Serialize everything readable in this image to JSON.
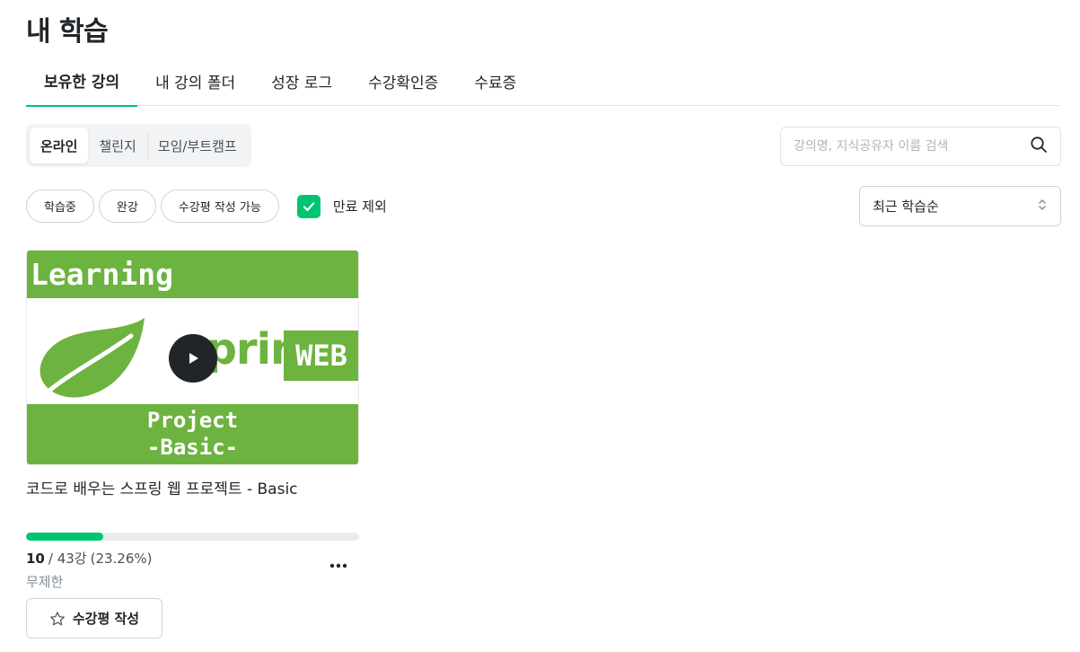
{
  "page_title": "내 학습",
  "tabs": [
    {
      "label": "보유한 강의",
      "active": true
    },
    {
      "label": "내 강의 폴더"
    },
    {
      "label": "성장 로그"
    },
    {
      "label": "수강확인증"
    },
    {
      "label": "수료증"
    }
  ],
  "segments": [
    {
      "label": "온라인",
      "active": true
    },
    {
      "label": "챌린지"
    },
    {
      "label": "모임/부트캠프"
    }
  ],
  "search": {
    "placeholder": "강의명, 지식공유자 이름 검색",
    "icon": "search-icon"
  },
  "chips": [
    "학습중",
    "완강",
    "수강평 작성 가능"
  ],
  "exclude_expired": {
    "label": "만료 제외",
    "checked": true
  },
  "sort": {
    "label": "최근 학습순",
    "icon": "updown-chevron-icon"
  },
  "course": {
    "thumbnail": {
      "top_text": "Learning",
      "brand_text": "spring",
      "badge_text": "WEB",
      "bottom_line1": "Project",
      "bottom_line2": "-Basic-"
    },
    "title": "코드로 배우는 스프링 웹 프로젝트 - Basic",
    "progress_fraction": 0.2326,
    "completed": "10",
    "total_text": "/ 43강",
    "percent_text": "(23.26%)",
    "period": "무제한",
    "review_button": "수강평 작성"
  },
  "colors": {
    "accent": "#00c471",
    "spring_green": "#6db33f",
    "text": "#212529",
    "muted": "#868e96"
  }
}
